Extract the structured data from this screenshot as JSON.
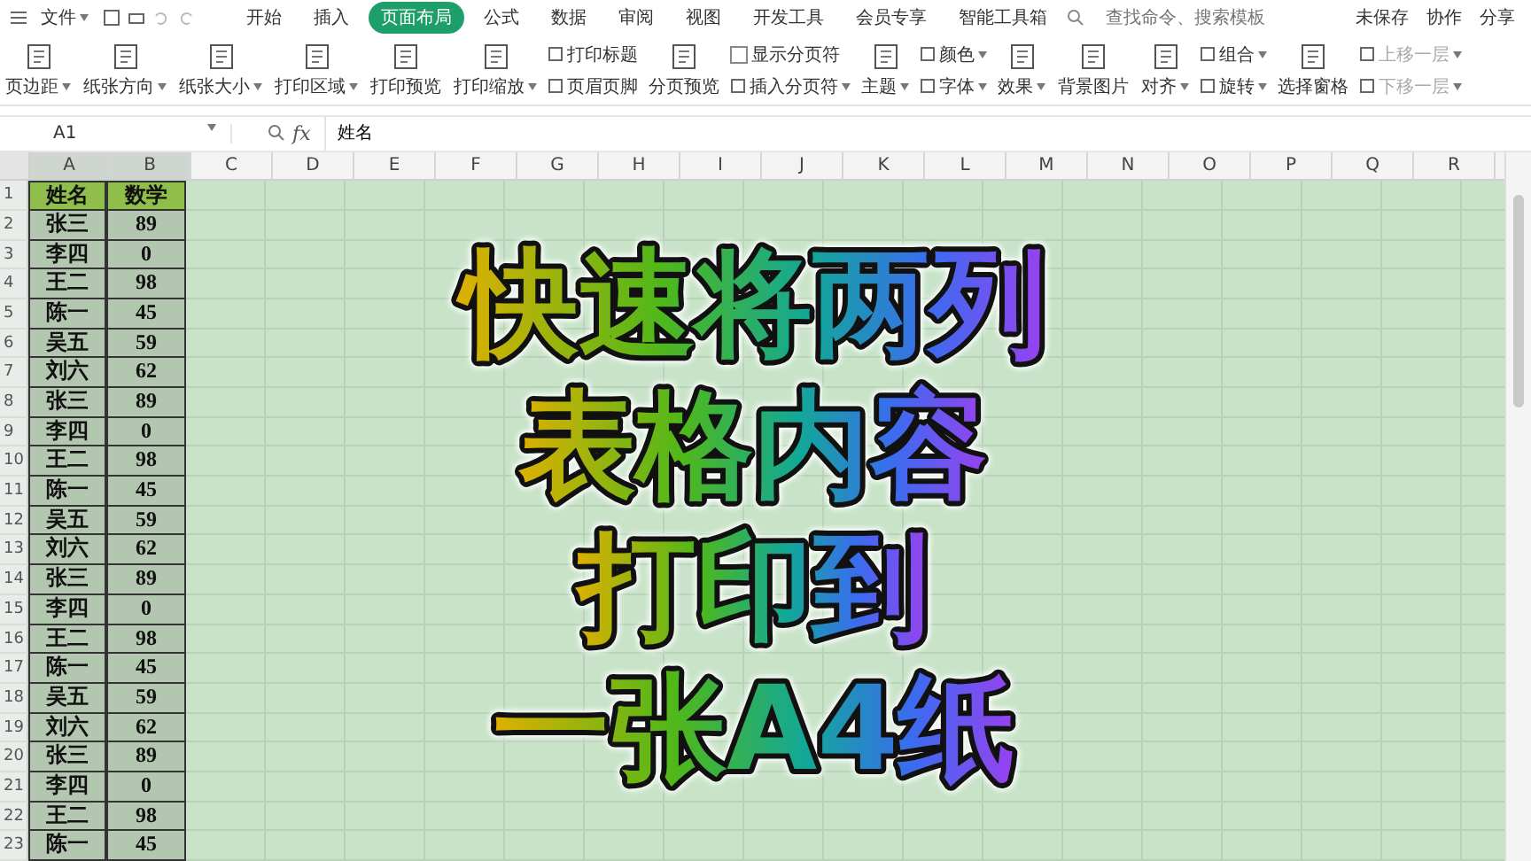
{
  "menu_bar": {
    "file_menu": "文件",
    "tabs": [
      {
        "label": "开始",
        "selected": false
      },
      {
        "label": "插入",
        "selected": false
      },
      {
        "label": "页面布局",
        "selected": true
      },
      {
        "label": "公式",
        "selected": false
      },
      {
        "label": "数据",
        "selected": false
      },
      {
        "label": "审阅",
        "selected": false
      },
      {
        "label": "视图",
        "selected": false
      },
      {
        "label": "开发工具",
        "selected": false
      },
      {
        "label": "会员专享",
        "selected": false
      },
      {
        "label": "智能工具箱",
        "selected": false
      }
    ],
    "search": {
      "placeholder": "查找命令、搜索模板"
    },
    "actions": [
      "未保存",
      "协作",
      "分享"
    ]
  },
  "ribbon": [
    {
      "kind": "big",
      "label": "页边距",
      "dropdown": true
    },
    {
      "kind": "big",
      "label": "纸张方向",
      "dropdown": true
    },
    {
      "kind": "big",
      "label": "纸张大小",
      "dropdown": true
    },
    {
      "kind": "big",
      "label": "打印区域",
      "dropdown": true
    },
    {
      "kind": "big",
      "label": "打印预览",
      "dropdown": false
    },
    {
      "kind": "big",
      "label": "打印缩放",
      "dropdown": true
    },
    {
      "kind": "stack",
      "items": [
        {
          "label": "打印标题",
          "dropdown": false,
          "disabled": false
        },
        {
          "label": "页眉页脚",
          "dropdown": false,
          "disabled": false
        }
      ]
    },
    {
      "kind": "big",
      "label": "分页预览",
      "dropdown": false
    },
    {
      "kind": "stack",
      "items": [
        {
          "label": "显示分页符",
          "dropdown": false,
          "disabled": false,
          "checked": false
        },
        {
          "label": "插入分页符",
          "dropdown": true,
          "disabled": false
        }
      ]
    },
    {
      "kind": "big",
      "label": "主题",
      "dropdown": true
    },
    {
      "kind": "stack",
      "items": [
        {
          "label": "颜色",
          "dropdown": true,
          "disabled": false
        },
        {
          "label": "字体",
          "dropdown": true,
          "disabled": false
        }
      ]
    },
    {
      "kind": "big",
      "label": "效果",
      "dropdown": true
    },
    {
      "kind": "big",
      "label": "背景图片",
      "dropdown": false
    },
    {
      "kind": "big",
      "label": "对齐",
      "dropdown": true
    },
    {
      "kind": "stack",
      "items": [
        {
          "label": "组合",
          "dropdown": true,
          "disabled": false
        },
        {
          "label": "旋转",
          "dropdown": true,
          "disabled": false
        }
      ]
    },
    {
      "kind": "big",
      "label": "选择窗格",
      "dropdown": false
    },
    {
      "kind": "stack",
      "items": [
        {
          "label": "上移一层",
          "dropdown": true,
          "disabled": true
        },
        {
          "label": "下移一层",
          "dropdown": true,
          "disabled": true
        }
      ]
    }
  ],
  "formula_bar": {
    "cell_ref": "A1",
    "fx_label": "fx",
    "formula": "姓名"
  },
  "columns": [
    {
      "label": "A",
      "selected": true
    },
    {
      "label": "B",
      "selected": true
    },
    {
      "label": "C",
      "selected": false
    },
    {
      "label": "D",
      "selected": false
    },
    {
      "label": "E",
      "selected": false
    },
    {
      "label": "F",
      "selected": false
    },
    {
      "label": "G",
      "selected": false
    },
    {
      "label": "H",
      "selected": false
    },
    {
      "label": "I",
      "selected": false
    },
    {
      "label": "J",
      "selected": false
    },
    {
      "label": "K",
      "selected": false
    },
    {
      "label": "L",
      "selected": false
    },
    {
      "label": "M",
      "selected": false
    },
    {
      "label": "N",
      "selected": false
    },
    {
      "label": "O",
      "selected": false
    },
    {
      "label": "P",
      "selected": false
    },
    {
      "label": "Q",
      "selected": false
    },
    {
      "label": "R",
      "selected": false
    }
  ],
  "rows": [
    {
      "num": "1",
      "a": "姓名",
      "b": "数学",
      "kind": "header"
    },
    {
      "num": "2",
      "a": "张三",
      "b": "89",
      "kind": "data"
    },
    {
      "num": "3",
      "a": "李四",
      "b": "0",
      "kind": "data"
    },
    {
      "num": "4",
      "a": "王二",
      "b": "98",
      "kind": "data"
    },
    {
      "num": "5",
      "a": "陈一",
      "b": "45",
      "kind": "data"
    },
    {
      "num": "6",
      "a": "吴五",
      "b": "59",
      "kind": "data"
    },
    {
      "num": "7",
      "a": "刘六",
      "b": "62",
      "kind": "data"
    },
    {
      "num": "8",
      "a": "张三",
      "b": "89",
      "kind": "data"
    },
    {
      "num": "9",
      "a": "李四",
      "b": "0",
      "kind": "data"
    },
    {
      "num": "10",
      "a": "王二",
      "b": "98",
      "kind": "data"
    },
    {
      "num": "11",
      "a": "陈一",
      "b": "45",
      "kind": "data"
    },
    {
      "num": "12",
      "a": "吴五",
      "b": "59",
      "kind": "data"
    },
    {
      "num": "13",
      "a": "刘六",
      "b": "62",
      "kind": "data"
    },
    {
      "num": "14",
      "a": "张三",
      "b": "89",
      "kind": "data"
    },
    {
      "num": "15",
      "a": "李四",
      "b": "0",
      "kind": "data"
    },
    {
      "num": "16",
      "a": "王二",
      "b": "98",
      "kind": "data"
    },
    {
      "num": "17",
      "a": "陈一",
      "b": "45",
      "kind": "data"
    },
    {
      "num": "18",
      "a": "吴五",
      "b": "59",
      "kind": "data"
    },
    {
      "num": "19",
      "a": "刘六",
      "b": "62",
      "kind": "data"
    },
    {
      "num": "20",
      "a": "张三",
      "b": "89",
      "kind": "data"
    },
    {
      "num": "21",
      "a": "李四",
      "b": "0",
      "kind": "data"
    },
    {
      "num": "22",
      "a": "王二",
      "b": "98",
      "kind": "data"
    },
    {
      "num": "23",
      "a": "陈一",
      "b": "45",
      "kind": "data"
    }
  ],
  "overlay_title": [
    "快速将两列",
    "表格内容",
    "打印到",
    "一张A4纸"
  ]
}
